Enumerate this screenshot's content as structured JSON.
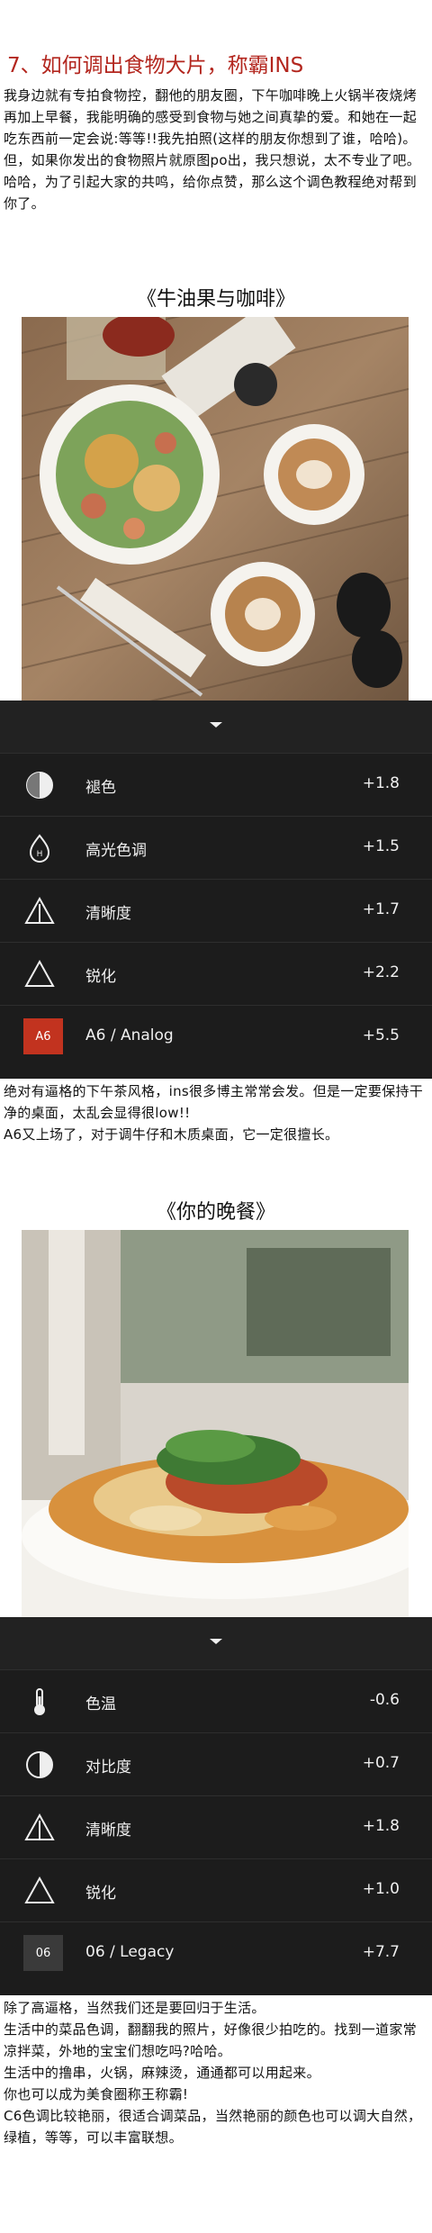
{
  "section1": {
    "heading": "7、如何调出食物大片，称霸INS",
    "paragraphs": [
      "我身边就有专拍食物控，翻他的朋友圈，下午咖啡晚上火锅半夜烧烤再加上早餐，我能明确的感受到食物与她之间真挚的爱。和她在一起吃东西前一定会说:等等!!我先拍照(这样的朋友你想到了谁，哈哈)。",
      "但，如果你发出的食物照片就原图po出，我只想说，太不专业了吧。哈哈，为了引起大家的共鸣，给你点赞，那么这个调色教程绝对帮到你了。"
    ]
  },
  "recipe1": {
    "caption": "《牛油果与咖啡》",
    "rows": [
      {
        "icon": "fade-icon",
        "label": "褪色",
        "value": "+1.8"
      },
      {
        "icon": "highlight-tint-icon",
        "label": "高光色调",
        "value": "+1.5"
      },
      {
        "icon": "clarity-icon",
        "label": "清晰度",
        "value": "+1.7"
      },
      {
        "icon": "sharpen-icon",
        "label": "锐化",
        "value": "+2.2"
      },
      {
        "icon": "preset-badge",
        "badge": "A6",
        "label": "A6 / Analog",
        "value": "+5.5"
      }
    ],
    "description": [
      "绝对有逼格的下午茶风格，ins很多博主常常会发。但是一定要保持干净的桌面，太乱会显得很low!!",
      "A6又上场了，对于调牛仔和木质桌面，它一定很擅长。"
    ]
  },
  "recipe2": {
    "caption": "《你的晚餐》",
    "rows": [
      {
        "icon": "temperature-icon",
        "label": "色温",
        "value": "-0.6"
      },
      {
        "icon": "contrast-icon",
        "label": "对比度",
        "value": "+0.7"
      },
      {
        "icon": "clarity-icon",
        "label": "清晰度",
        "value": "+1.8"
      },
      {
        "icon": "sharpen-icon",
        "label": "锐化",
        "value": "+1.0"
      },
      {
        "icon": "preset-badge",
        "badge": "06",
        "label": "06 / Legacy",
        "value": "+7.7"
      }
    ],
    "description": [
      "除了高逼格，当然我们还是要回归于生活。",
      "生活中的菜品色调，翻翻我的照片，好像很少拍吃的。找到一道家常凉拌菜，外地的宝宝们想吃吗?哈哈。",
      "生活中的撸串，火锅，麻辣烫，通通都可以用起来。",
      "你也可以成为美食圈称王称霸!",
      "C6色调比较艳丽，很适合调菜品，当然艳丽的颜色也可以调大自然，绿植，等等，可以丰富联想。"
    ]
  },
  "colors": {
    "heading": "#b3261e",
    "panel": "#1c1c1c",
    "badge_a6": "#c2331f",
    "badge_06": "#3a3a3a"
  }
}
